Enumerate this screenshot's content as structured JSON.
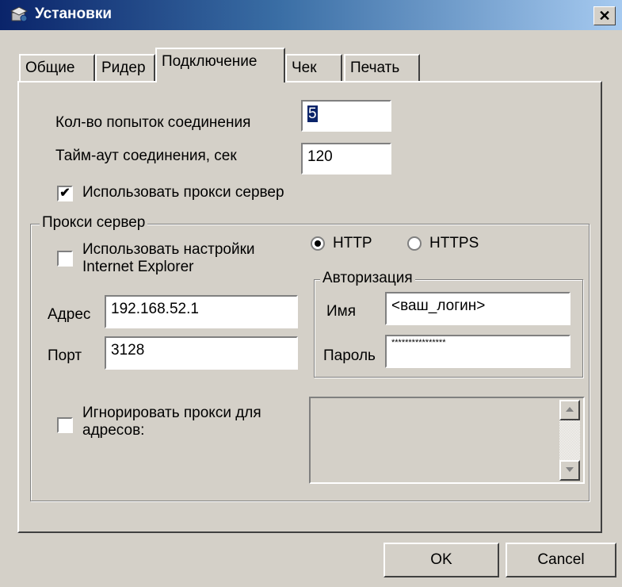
{
  "window": {
    "title": "Установки",
    "close_glyph": "✕"
  },
  "tabs": [
    {
      "label": "Общие"
    },
    {
      "label": "Ридер"
    },
    {
      "label": "Подключение"
    },
    {
      "label": "Чек"
    },
    {
      "label": "Печать"
    }
  ],
  "active_tab": "Подключение",
  "connection": {
    "attempts_label": "Кол-во попыток соединения",
    "attempts_value": "5",
    "timeout_label": "Тайм-аут соединения, сек",
    "timeout_value": "120",
    "use_proxy_label": "Использовать прокси сервер",
    "use_proxy_checked": true
  },
  "proxy": {
    "group_label": "Прокси сервер",
    "use_ie_label_line1": "Использовать настройки",
    "use_ie_label_line2": "Internet Explorer",
    "use_ie_checked": false,
    "http_label": "HTTP",
    "https_label": "HTTPS",
    "protocol_selected": "HTTP",
    "address_label": "Адрес",
    "address_value": "192.168.52.1",
    "port_label": "Порт",
    "port_value": "3128",
    "auth": {
      "group_label": "Авторизация",
      "name_label": "Имя",
      "name_value": "<ваш_логин>",
      "password_label": "Пароль",
      "password_value": "****************"
    },
    "ignore_label_line1": "Игнорировать прокси для",
    "ignore_label_line2": "адресов:",
    "ignore_checked": false
  },
  "buttons": {
    "ok": "OK",
    "cancel": "Cancel"
  },
  "colors": {
    "face": "#d4d0c8",
    "title_start": "#0a246a",
    "title_end": "#a6caf0"
  }
}
